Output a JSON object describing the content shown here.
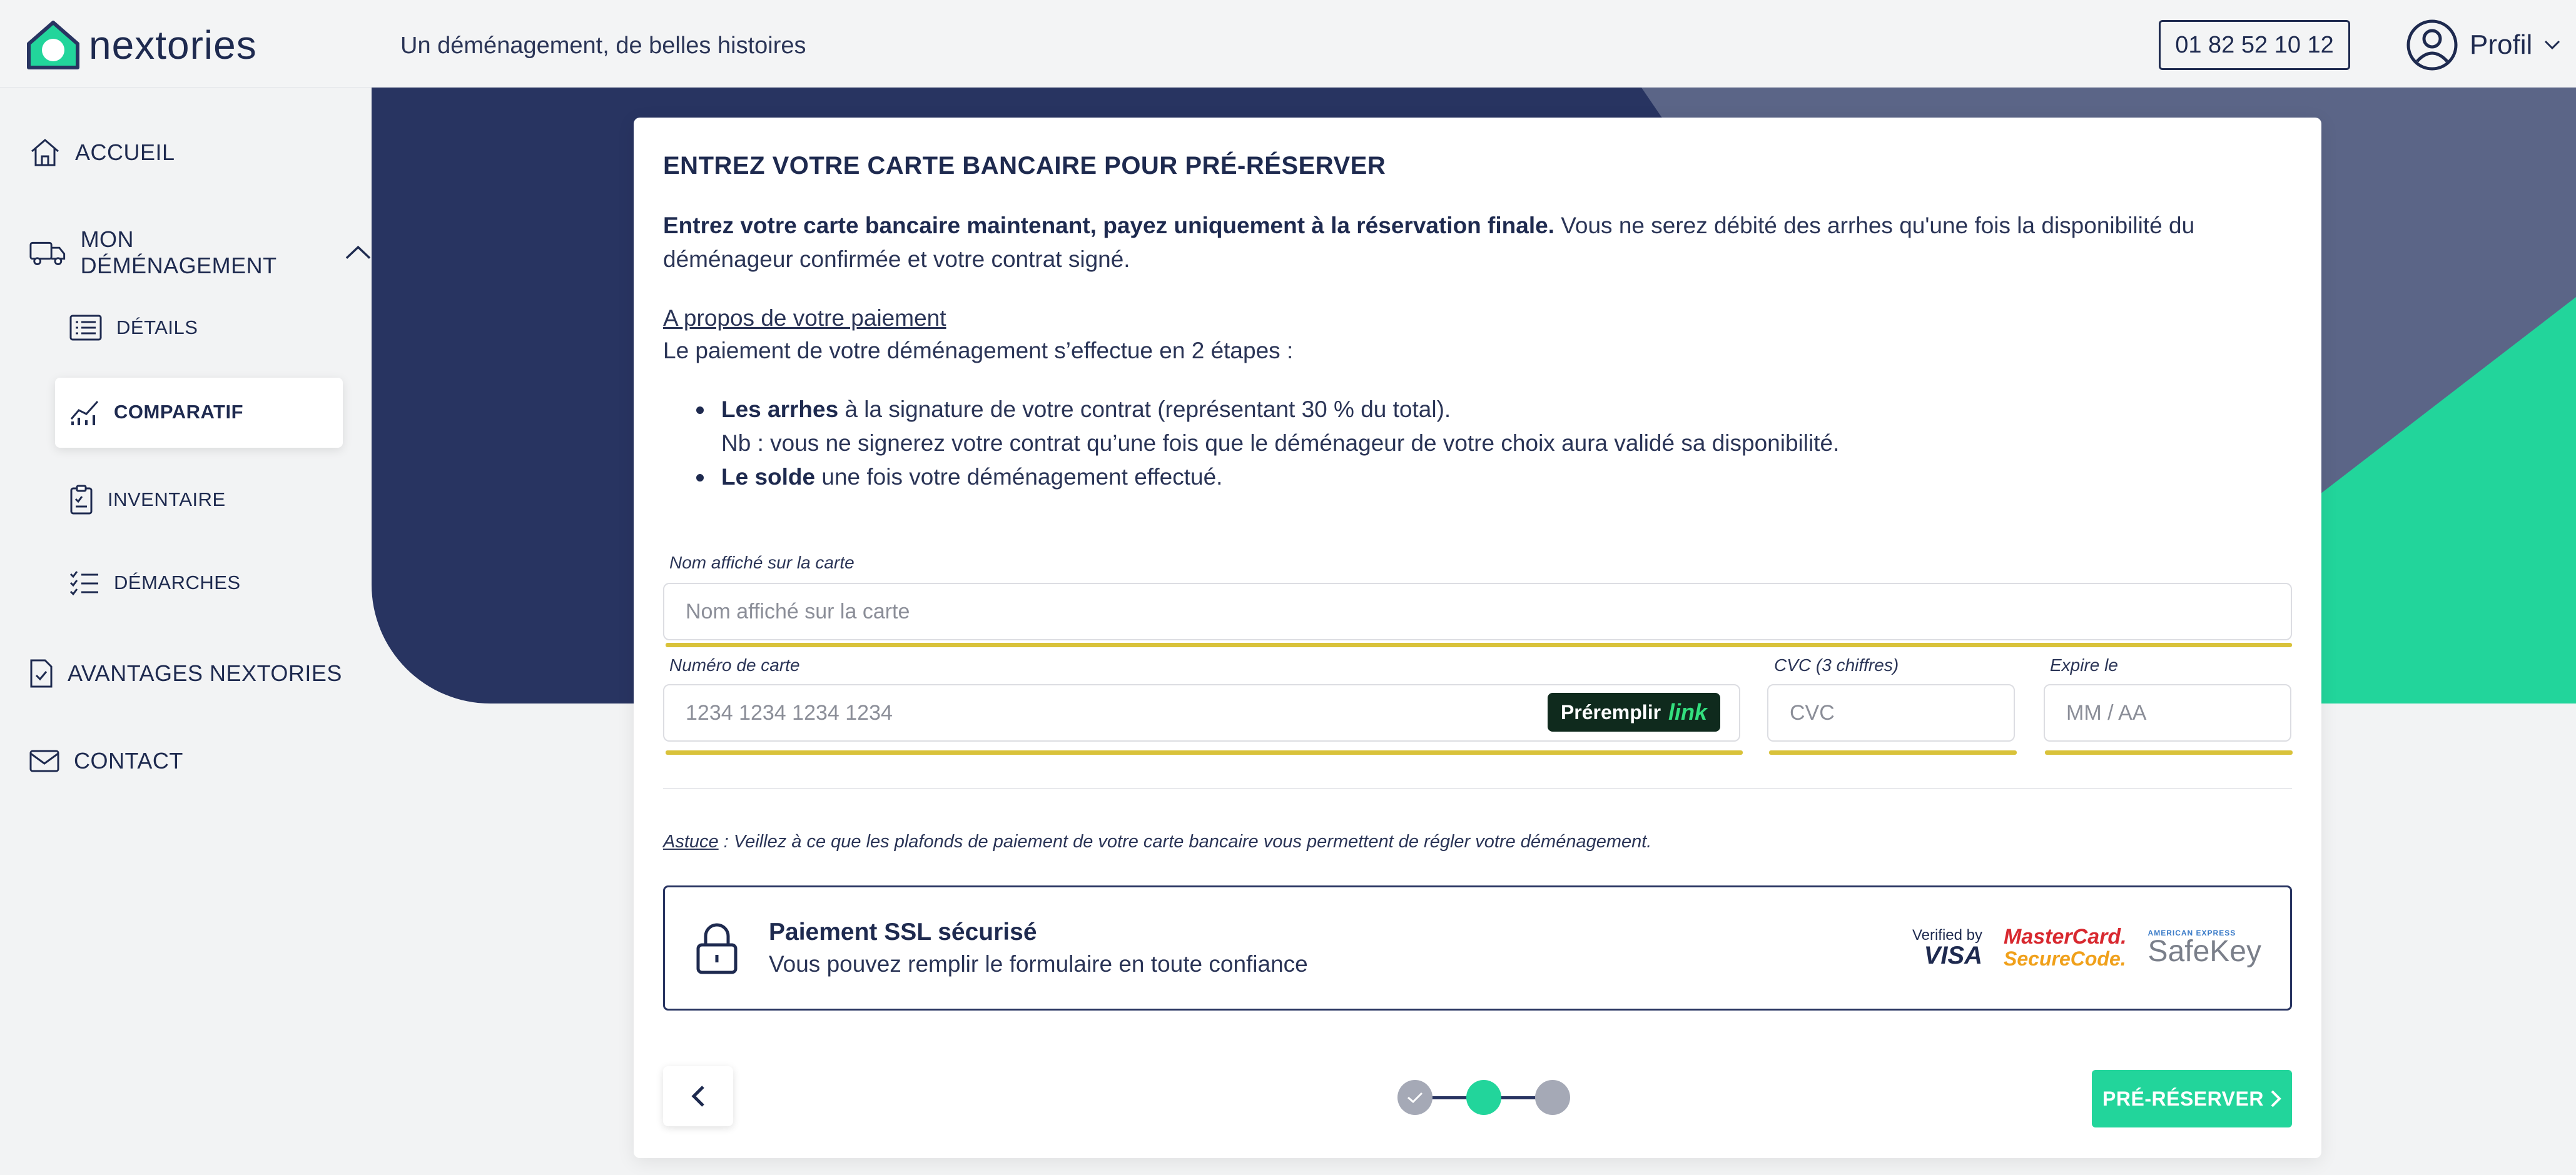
{
  "header": {
    "logo_text": "nextories",
    "tagline": "Un déménagement, de belles histoires",
    "phone": "01 82 52 10 12",
    "profile_label": "Profil"
  },
  "sidebar": {
    "items": [
      {
        "label": "ACCUEIL",
        "icon": "home-icon"
      },
      {
        "label": "MON DÉMÉNAGEMENT",
        "icon": "truck-icon"
      },
      {
        "label": "DÉTAILS",
        "icon": "list-icon"
      },
      {
        "label": "COMPARATIF",
        "icon": "chart-icon",
        "active": true
      },
      {
        "label": "INVENTAIRE",
        "icon": "clipboard-icon"
      },
      {
        "label": "DÉMARCHES",
        "icon": "checklist-icon"
      },
      {
        "label": "AVANTAGES NEXTORIES",
        "icon": "document-icon"
      },
      {
        "label": "CONTACT",
        "icon": "mail-icon"
      }
    ]
  },
  "card": {
    "title": "ENTREZ VOTRE CARTE BANCAIRE POUR PRÉ-RÉSERVER",
    "intro_bold": "Entrez votre carte bancaire maintenant, payez uniquement à la réservation finale.",
    "intro_rest": " Vous ne serez débité des arrhes qu'une fois la disponibilité du déménageur confirmée et votre contrat signé.",
    "payment_link": "A propos de votre paiement",
    "payment_steps": "Le paiement de votre déménagement s’effectue en 2 étapes :",
    "bullet1_bold": "Les arrhes",
    "bullet1_rest": " à la signature de votre contrat (représentant 30 % du total).",
    "bullet1_note": "Nb : vous ne signerez votre contrat qu’une fois que le déménageur de votre choix aura validé sa disponibilité.",
    "bullet2_bold": "Le solde",
    "bullet2_rest": " une fois votre déménagement effectué."
  },
  "form": {
    "name_label": "Nom affiché sur la carte",
    "name_placeholder": "Nom affiché sur la carte",
    "card_label": "Numéro de carte",
    "card_placeholder": "1234 1234 1234 1234",
    "link_prefill": "Préremplir",
    "link_brand": "link",
    "cvc_label": "CVC (3 chiffres)",
    "cvc_placeholder": "CVC",
    "expiry_label": "Expire le",
    "expiry_placeholder": "MM / AA"
  },
  "tip": {
    "title": "Astuce",
    "text": " : Veillez à ce que les plafonds de paiement de votre carte bancaire vous permettent de régler votre déménagement."
  },
  "ssl": {
    "title": "Paiement SSL sécurisé",
    "subtitle": "Vous pouvez remplir le formulaire en toute confiance",
    "visa_line1": "Verified by",
    "visa_line2": "VISA",
    "mc_line1": "MasterCard.",
    "mc_line2": "SecureCode.",
    "sk_line1": "AMERICAN EXPRESS",
    "sk_line2": "SafeKey"
  },
  "footer": {
    "cta_label": "PRÉ-RÉSERVER",
    "steps_total": 3,
    "current_step": 2
  },
  "colors": {
    "navy": "#283461",
    "slate": "#5b6587",
    "green": "#22d59b",
    "field_underline": "#d9c23a"
  }
}
